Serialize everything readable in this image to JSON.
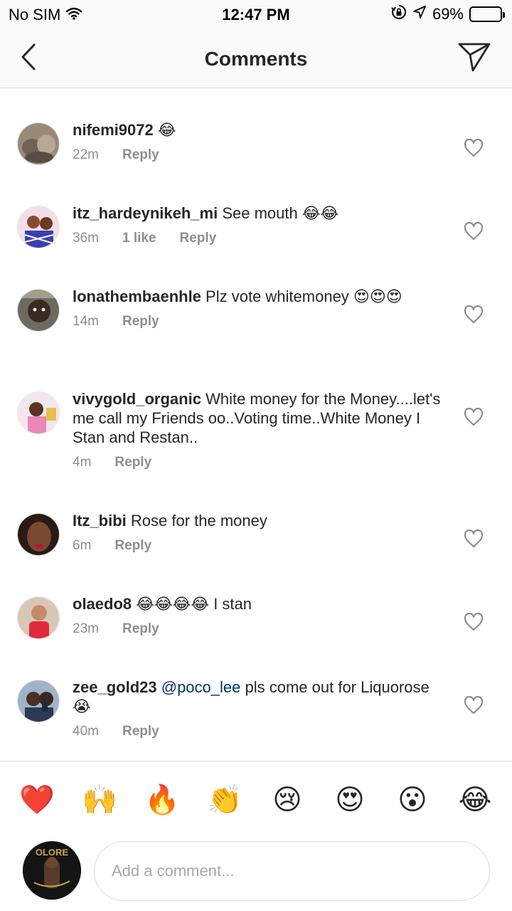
{
  "status_bar": {
    "carrier": "No SIM",
    "time": "12:47 PM",
    "battery": "69%",
    "battery_level": 0.69,
    "battery_color": "#f5c400"
  },
  "header": {
    "title": "Comments",
    "back_icon": "chevron-left-icon",
    "send_icon": "paper-plane-icon"
  },
  "comments": [
    {
      "username": "nifemi9072",
      "text": "😂",
      "time": "22m",
      "likes": "",
      "reply": "Reply"
    },
    {
      "username": "itz_hardeynikeh_mi",
      "text": "See mouth 😂😂",
      "time": "36m",
      "likes": "1 like",
      "reply": "Reply"
    },
    {
      "username": "lonathembaenhle",
      "text": "Plz vote whitemoney 😍😍😍",
      "time": "14m",
      "likes": "",
      "reply": "Reply"
    },
    {
      "username": "vivygold_organic",
      "text": "White money for the Money....let's me call my Friends oo..Voting time..White Money  I Stan and Restan..",
      "time": "4m",
      "likes": "",
      "reply": "Reply"
    },
    {
      "username": "Itz_bibi",
      "text": "Rose for the money",
      "time": "6m",
      "likes": "",
      "reply": "Reply"
    },
    {
      "username": "olaedo8",
      "text": "😂😂😂😂 I stan",
      "time": "23m",
      "likes": "",
      "reply": "Reply"
    },
    {
      "username": "zee_gold23",
      "mention": "@poco_lee",
      "text": "  pls come out for Liquorose 😭",
      "time": "40m",
      "likes": "",
      "reply": "Reply"
    }
  ],
  "emoji_bar": [
    "❤️",
    "🙌",
    "🔥",
    "👏",
    "😢",
    "😍",
    "😮",
    "😂"
  ],
  "composer": {
    "placeholder": "Add a comment...",
    "avatar_text": "OLORE"
  }
}
